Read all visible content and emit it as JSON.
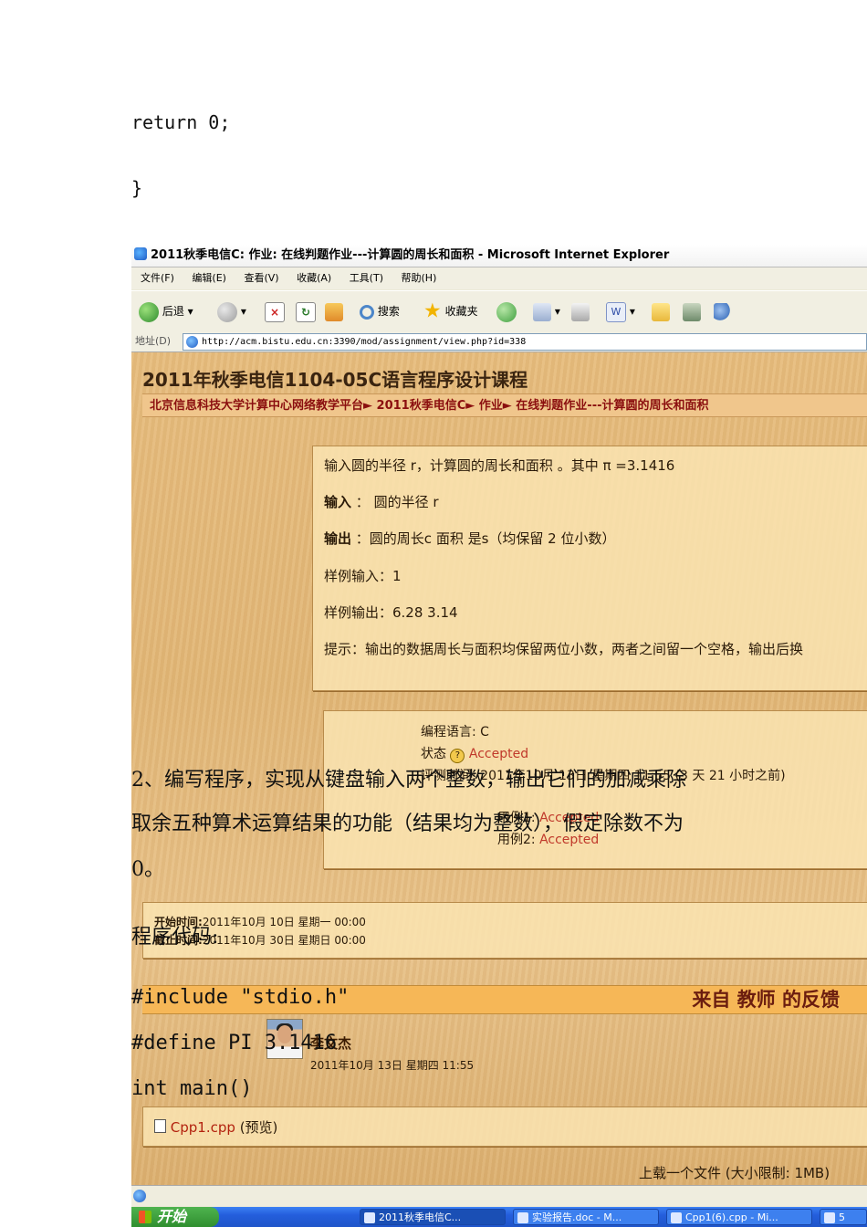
{
  "doc_top": {
    "line1": "return 0;",
    "line2": "}"
  },
  "ie": {
    "title": "2011秋季电信C: 作业: 在线判题作业---计算圆的周长和面积 - Microsoft Internet Explorer",
    "menu": [
      "文件(F)",
      "编辑(E)",
      "查看(V)",
      "收藏(A)",
      "工具(T)",
      "帮助(H)"
    ],
    "toolbar": {
      "back": "后退",
      "search": "搜索",
      "favorites": "收藏夹"
    },
    "address_label": "地址(D)",
    "address": "http://acm.bistu.edu.cn:3390/mod/assignment/view.php?id=338",
    "icons": {
      "back": "back-arrow-icon",
      "forward": "forward-arrow-icon",
      "stop": "stop-icon",
      "refresh": "refresh-icon",
      "home": "home-icon",
      "search": "search-icon",
      "favorites": "star-icon",
      "history": "history-icon",
      "mail": "mail-icon",
      "print": "print-icon",
      "word": "word-icon",
      "folder": "folder-icon",
      "messenger": "users-icon"
    }
  },
  "page": {
    "course_title": "2011年秋季电信1104-05C语言程序设计课程",
    "breadcrumb": "北京信息科技大学计算中心网络教学平台► 2011秋季电信C► 作业► 在线判题作业---计算圆的周长和面积",
    "problem": {
      "statement": "输入圆的半径 r，计算圆的周长和面积 。其中 π =3.1416",
      "input_label": "输入",
      "input_text": "： 圆的半径 r",
      "output_label": "输出",
      "output_text": "：圆的周长c 面积 是s（均保留 2 位小数）",
      "sample_input": "样例输入：1",
      "sample_output": "样例输出：6.28 3.14",
      "hint": "提示：输出的数据周长与面积均保留两位小数，两者之间留一个空格，输出后换"
    },
    "result": {
      "language": "编程语言: C",
      "status_label": "状态",
      "status_value": "Accepted",
      "judge_time": "评测时间: 2011年10月 13日 星期四 11:55 (3 天 21 小时之前)",
      "case1_label": "用例1:",
      "case1_value": "Accepted",
      "case2_label": "用例2:",
      "case2_value": "Accepted"
    },
    "dates": {
      "start_label": "开始时间:",
      "start_value": "2011年10月 10日 星期一 00:00",
      "end_label": "截止时间:",
      "end_value": "2011年10月 30日 星期日 00:00"
    },
    "feedback_title": "来自 教师 的反馈",
    "teacher_name": "李文杰",
    "teacher_time": "2011年10月 13日 星期四 11:55",
    "file_name": "Cpp1.cpp",
    "file_preview": "(预览)",
    "upload_text": "上载一个文件 (大小限制: 1MB)"
  },
  "taskbar": {
    "start": "开始",
    "tasks": [
      "2011秋季电信C...",
      "实验报告.doc - M...",
      "Cpp1(6).cpp - Mi...",
      "5"
    ]
  },
  "doc_overlay": {
    "task_line1": "2、编写程序，实现从键盘输入两个整数，输出它们的加减乘除",
    "task_line2": "取余五种算术运算结果的功能（结果均为整数），假定除数不为",
    "task_line3": "0。",
    "code_label": "程序代码:",
    "code1": "#include \"stdio.h\"",
    "code2": "#define PI 3.1416",
    "code3": "int main()"
  }
}
